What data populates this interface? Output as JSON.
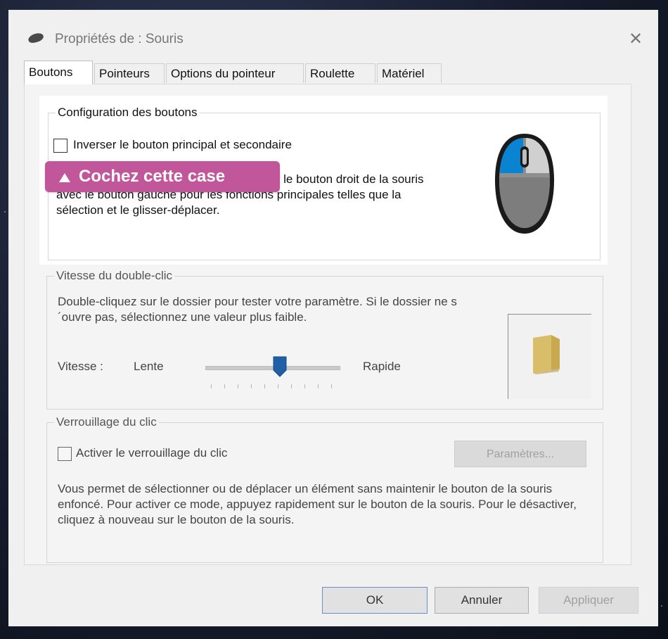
{
  "dialog": {
    "title": "Propriétés de : Souris",
    "close_glyph": "✕"
  },
  "tabs": [
    {
      "label": "Boutons",
      "active": true
    },
    {
      "label": "Pointeurs"
    },
    {
      "label": "Options du pointeur"
    },
    {
      "label": "Roulette"
    },
    {
      "label": "Matériel"
    }
  ],
  "button_config": {
    "legend": "Configuration des boutons",
    "checkbox_label": "Inverser le bouton principal et secondaire",
    "checked": false,
    "description": "Activez cette case à cocher pour permuter le bouton droit de la souris avec le bouton gauche pour les fonctions principales telles que la sélection et le glisser-déplacer.",
    "mouse_icon": "mouse-icon"
  },
  "callout": {
    "text": "Cochez cette case",
    "icon": "triangle-up-icon",
    "color": "#c2569a"
  },
  "double_click": {
    "legend": "Vitesse du double-clic",
    "description": "Double-cliquez sur le dossier pour tester votre paramètre. Si le dossier ne s´ouvre pas, sélectionnez une valeur plus faible.",
    "speed_label": "Vitesse :",
    "slow_label": "Lente",
    "fast_label": "Rapide",
    "slider_value": 0.55,
    "folder_icon": "folder-icon"
  },
  "click_lock": {
    "legend": "Verrouillage du clic",
    "checkbox_label": "Activer le verrouillage du clic",
    "checked": false,
    "settings_button": "Paramètres...",
    "description": "Vous permet de sélectionner ou de déplacer un élément sans maintenir le bouton de la souris enfoncé. Pour activer ce mode, appuyez rapidement sur le bouton de la souris. Pour le désactiver, cliquez à nouveau sur le bouton de la souris."
  },
  "footer": {
    "ok": "OK",
    "cancel": "Annuler",
    "apply": "Appliquer"
  },
  "colors": {
    "accent_blue": "#0a84d0",
    "callout_pink": "#c2569a",
    "slider_thumb": "#1f5fa6"
  }
}
